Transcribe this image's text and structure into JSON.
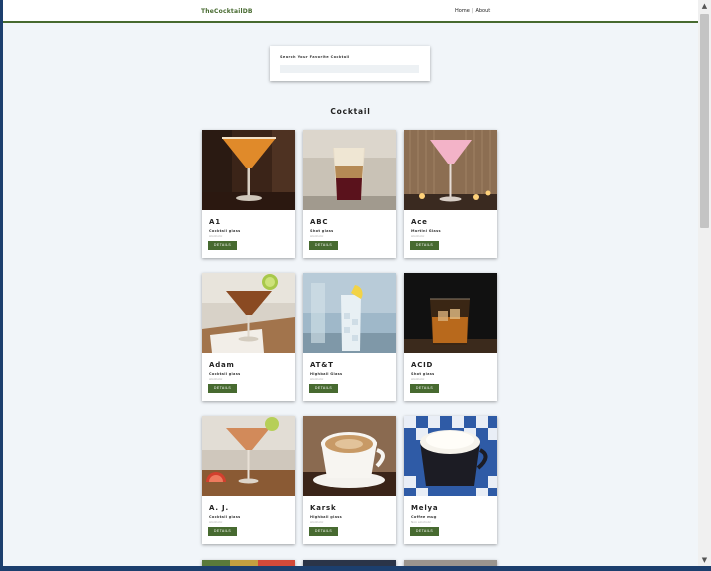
{
  "navbar": {
    "brand": "TheCocktailDB",
    "links": [
      {
        "label": "Home"
      },
      {
        "label": "About"
      }
    ],
    "separator": "|"
  },
  "search": {
    "label": "Search Your Favorite Cocktail",
    "value": ""
  },
  "section": {
    "title": "Cocktail"
  },
  "cards": [
    {
      "name": "A1",
      "glass": "Cocktail glass",
      "type": "Alcoholic",
      "button": "DETAILS"
    },
    {
      "name": "ABC",
      "glass": "Shot glass",
      "type": "Alcoholic",
      "button": "DETAILS"
    },
    {
      "name": "Ace",
      "glass": "Martini Glass",
      "type": "Alcoholic",
      "button": "DETAILS"
    },
    {
      "name": "Adam",
      "glass": "Cocktail glass",
      "type": "Alcoholic",
      "button": "DETAILS"
    },
    {
      "name": "AT&T",
      "glass": "Highball Glass",
      "type": "Alcoholic",
      "button": "DETAILS"
    },
    {
      "name": "ACID",
      "glass": "Shot glass",
      "type": "Alcoholic",
      "button": "DETAILS"
    },
    {
      "name": "A. J.",
      "glass": "Cocktail glass",
      "type": "Alcoholic",
      "button": "DETAILS"
    },
    {
      "name": "Karsk",
      "glass": "Highball glass",
      "type": "Alcoholic",
      "button": "DETAILS"
    },
    {
      "name": "Melya",
      "glass": "Coffee mug",
      "type": "Non alcoholic",
      "button": "DETAILS"
    }
  ],
  "colors": {
    "accent": "#476a30",
    "page_background": "#f1f5f9"
  },
  "scrollbar": {
    "up_icon": "chevron-up-icon",
    "down_icon": "chevron-down-icon"
  }
}
